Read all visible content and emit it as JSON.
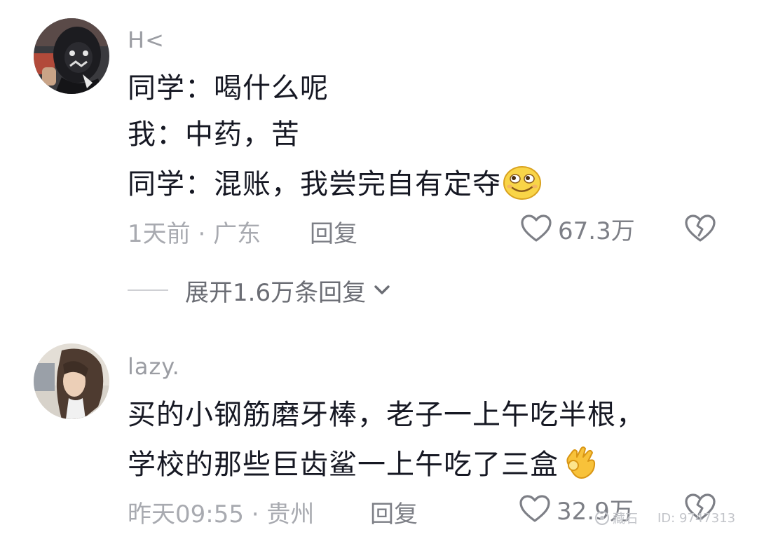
{
  "comments": [
    {
      "author": "H<",
      "lines": [
        "同学：喝什么呢",
        "我：中药，苦",
        "同学：混账，我尝完自有定夺"
      ],
      "time": "1天前",
      "location": "广东",
      "reply_label": "回复",
      "likes": "67.3万",
      "emoji_icon": "smirk-face-icon"
    },
    {
      "author": "lazy.",
      "lines": [
        "买的小钢筋磨牙棒，老子一上午吃半根，",
        "学校的那些巨齿鲨一上午吃了三盒"
      ],
      "time": "昨天09:55",
      "location": "贵州",
      "reply_label": "回复",
      "likes": "32.9万",
      "emoji_icon": "ok-hand-icon"
    }
  ],
  "expand_replies": {
    "label": "展开1.6万条回复"
  },
  "watermark": {
    "brand": "藏石",
    "id": "ID: 9747313"
  },
  "colors": {
    "text_primary": "#161823",
    "text_secondary": "#9b9da3",
    "icon_gray": "#7d7f86"
  }
}
